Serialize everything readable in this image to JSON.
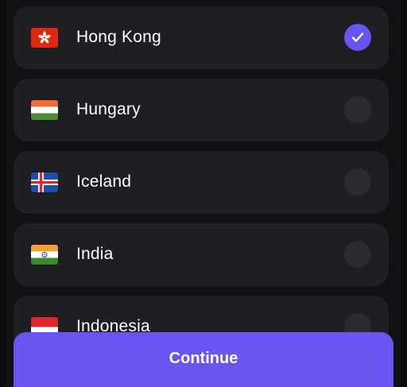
{
  "countries": [
    {
      "name": "Hong Kong",
      "flag_icon": "hong-kong-flag-icon",
      "selected": true
    },
    {
      "name": "Hungary",
      "flag_icon": "hungary-flag-icon",
      "selected": false
    },
    {
      "name": "Iceland",
      "flag_icon": "iceland-flag-icon",
      "selected": false
    },
    {
      "name": "India",
      "flag_icon": "india-flag-icon",
      "selected": false
    },
    {
      "name": "Indonesia",
      "flag_icon": "indonesia-flag-icon",
      "selected": false
    }
  ],
  "continue_label": "Continue",
  "colors": {
    "background": "#111113",
    "row_background": "#1f1f23",
    "accent": "#6955f2",
    "radio_unselected": "#2b2b30",
    "text": "#ffffff"
  }
}
